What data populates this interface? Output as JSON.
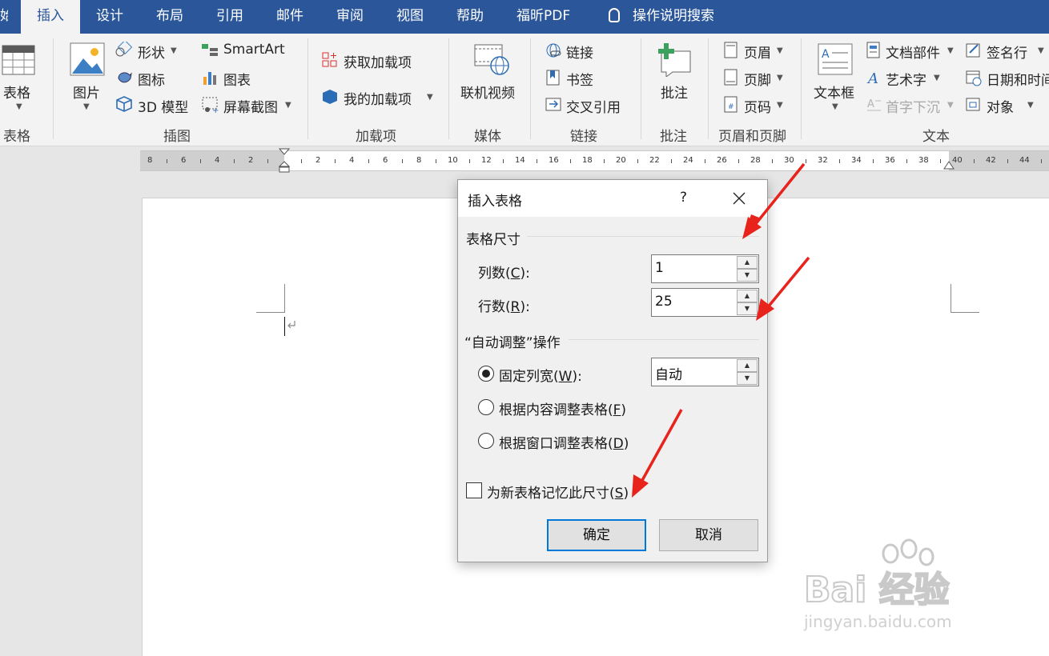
{
  "tabs": {
    "partial": "始",
    "insert": "插入",
    "design": "设计",
    "layout": "布局",
    "references": "引用",
    "mailings": "邮件",
    "review": "审阅",
    "view": "视图",
    "help": "帮助",
    "foxit": "福昕PDF",
    "tell_me": "操作说明搜索"
  },
  "ribbon": {
    "table": {
      "label": "表格",
      "group": "表格"
    },
    "illustrations": {
      "group": "插图",
      "picture": "图片",
      "shapes": "形状",
      "icons": "图标",
      "model3d": "3D 模型",
      "smartart": "SmartArt",
      "chart": "图表",
      "screenshot": "屏幕截图"
    },
    "addins": {
      "group": "加载项",
      "get": "获取加载项",
      "my": "我的加载项"
    },
    "media": {
      "group": "媒体",
      "online_video": "联机视频"
    },
    "links": {
      "group": "链接",
      "link": "链接",
      "bookmark": "书签",
      "cross_ref": "交叉引用"
    },
    "comments": {
      "group": "批注",
      "comment": "批注"
    },
    "header_footer": {
      "group": "页眉和页脚",
      "header": "页眉",
      "footer": "页脚",
      "page_number": "页码"
    },
    "text": {
      "group": "文本",
      "textbox": "文本框",
      "quick_parts": "文档部件",
      "wordart": "艺术字",
      "drop_cap": "首字下沉",
      "signature": "签名行",
      "datetime": "日期和时间",
      "object": "对象"
    }
  },
  "ruler": {
    "labels": [
      "8",
      "6",
      "4",
      "2",
      "2",
      "4",
      "6",
      "8",
      "10",
      "12",
      "14",
      "16",
      "18",
      "20",
      "22",
      "24",
      "26",
      "28",
      "30",
      "32",
      "34",
      "36",
      "38",
      "40",
      "42",
      "44"
    ]
  },
  "dialog": {
    "title": "插入表格",
    "help": "?",
    "size_section": "表格尺寸",
    "columns_label_pre": "列数(",
    "columns_key": "C",
    "columns_label_post": "):",
    "columns_value": "1",
    "rows_label_pre": "行数(",
    "rows_key": "R",
    "rows_label_post": "):",
    "rows_value": "25",
    "autofit_section": "“自动调整”操作",
    "fixed_pre": "固定列宽(",
    "fixed_key": "W",
    "fixed_post": "):",
    "fixed_value": "自动",
    "content_pre": "根据内容调整表格(",
    "content_key": "F",
    "content_post": ")",
    "window_pre": "根据窗口调整表格(",
    "window_key": "D",
    "window_post": ")",
    "remember_pre": "为新表格记忆此尺寸(",
    "remember_key": "S",
    "remember_post": ")",
    "ok": "确定",
    "cancel": "取消"
  },
  "watermark": {
    "brand": "Bai  经验",
    "url": "jingyan.baidu.com"
  },
  "colors": {
    "ribbon_blue": "#2b579a",
    "arrow_red": "#e8231c",
    "focus_blue": "#0078d7"
  }
}
